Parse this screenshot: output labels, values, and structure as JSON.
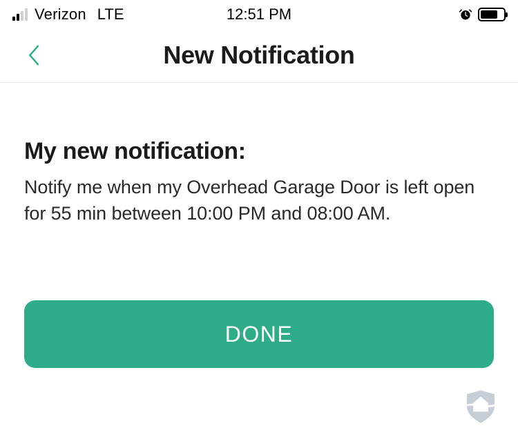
{
  "statusBar": {
    "carrier": "Verizon",
    "networkType": "LTE",
    "time": "12:51 PM"
  },
  "nav": {
    "title": "New Notification"
  },
  "content": {
    "heading": "My new notification:",
    "description": "Notify me when my Overhead Garage Door is left open for 55 min between 10:00 PM and 08:00 AM."
  },
  "actions": {
    "done": "DONE"
  }
}
